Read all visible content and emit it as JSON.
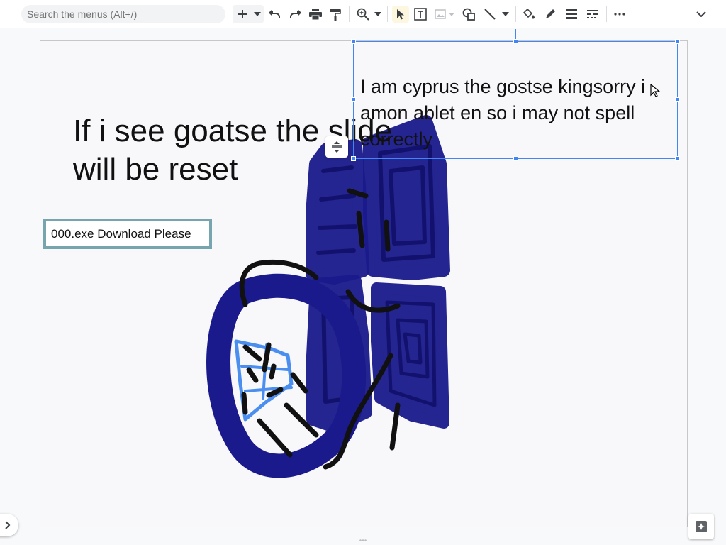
{
  "toolbar": {
    "search_placeholder": "Search the menus (Alt+/)",
    "icons": [
      "plus-icon",
      "dropdown-icon",
      "undo-icon",
      "redo-icon",
      "print-icon",
      "paint-format-icon",
      "zoom-icon",
      "select-icon",
      "text-box-icon",
      "image-icon",
      "shape-icon",
      "line-icon",
      "fill-color-icon",
      "border-color-icon",
      "border-weight-icon",
      "border-dash-icon",
      "more-icon",
      "collapse-icon"
    ]
  },
  "slide": {
    "title": "If i see goatse the slide will be reset",
    "download_box": "000.exe Download Please",
    "selected_textbox": "I am cyprus the gostse kingsorry i amon ablet en so i may not spell correctly"
  },
  "colors": {
    "accent": "#4285f4",
    "drawing_blue": "#1a1a8c",
    "drawing_light_blue": "#4a8ef0",
    "download_border": "#76a5af"
  }
}
